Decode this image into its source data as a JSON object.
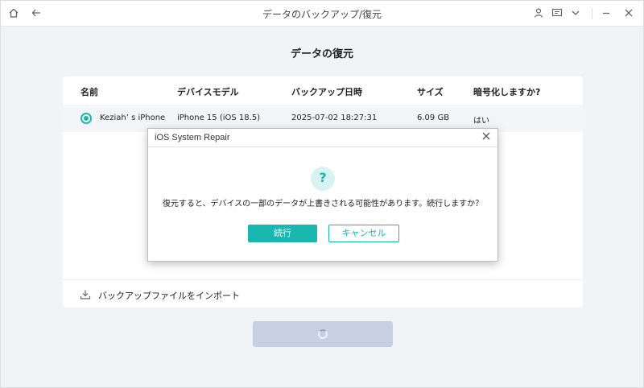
{
  "window": {
    "title": "データのバックアップ/復元",
    "icons": [
      "home-icon",
      "back-arrow-icon",
      "user-icon",
      "feedback-icon",
      "chevron-down-icon",
      "minimize-icon",
      "close-icon"
    ]
  },
  "page": {
    "title": "データの復元"
  },
  "table": {
    "headers": [
      "名前",
      "デバイスモデル",
      "バックアップ日時",
      "サイズ",
      "暗号化しますか?"
    ],
    "rows": [
      {
        "selected": true,
        "name": "Keziah’ s iPhone",
        "model": "iPhone 15 (iOS 18.5)",
        "date": "2025-07-02 18:27:31",
        "size": "6.09 GB",
        "encrypted": "はい"
      }
    ]
  },
  "import": {
    "label": "バックアップファイルをインポート"
  },
  "dialog": {
    "title": "iOS System Repair",
    "message": "復元すると、デバイスの一部のデータが上書きされる可能性があります。続行しますか？",
    "continue_label": "続行",
    "cancel_label": "キャンセル"
  },
  "colors": {
    "accent": "#18b8b0",
    "disabled_button": "#c7d0e3"
  }
}
